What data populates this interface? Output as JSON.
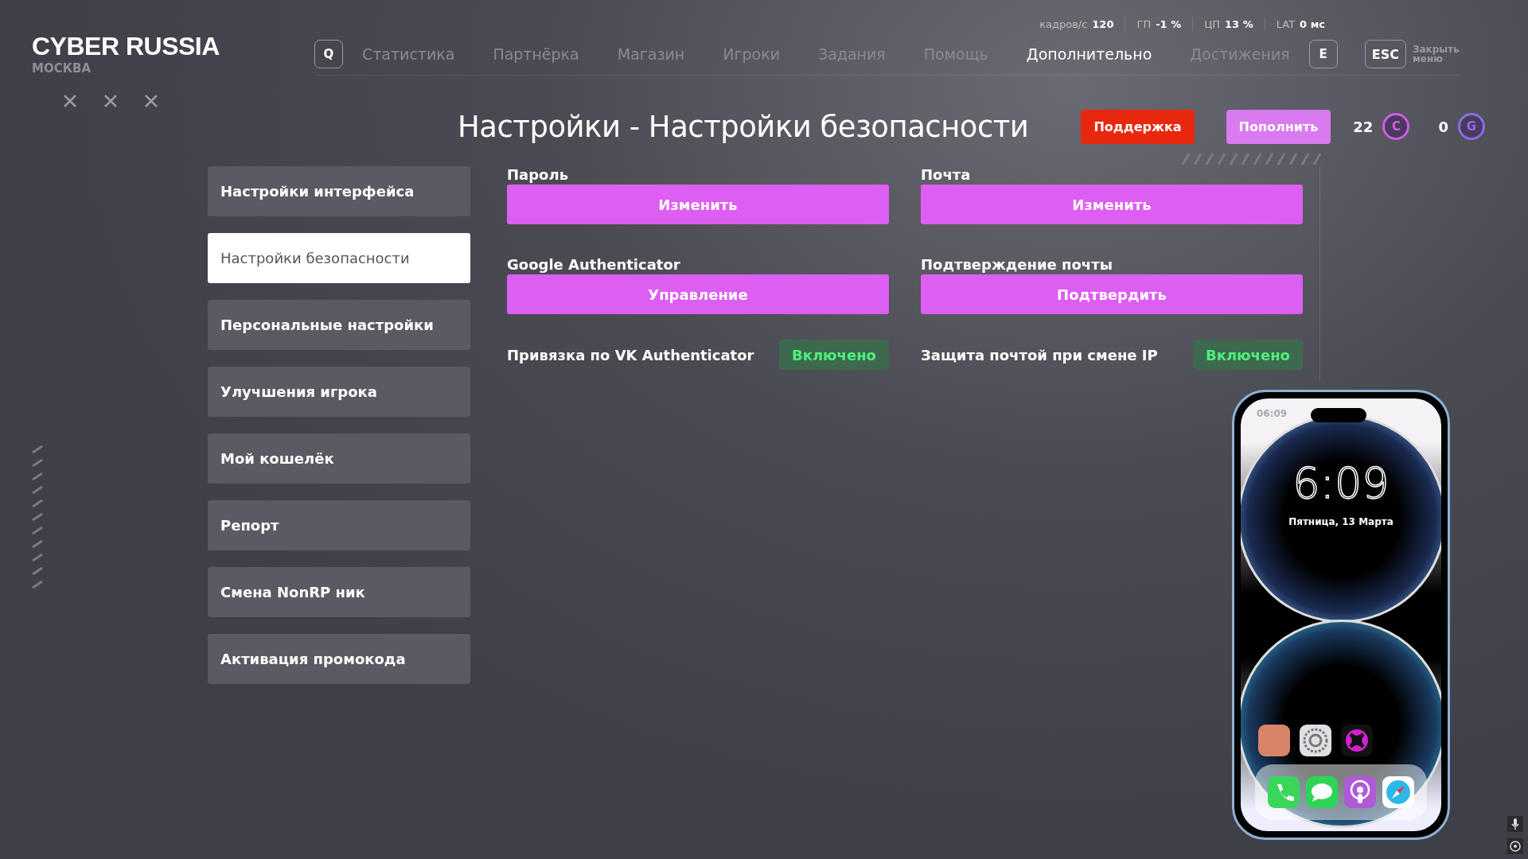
{
  "brand": {
    "title": "CYBER RUSSIA",
    "city": "МОСКВА"
  },
  "stats": [
    {
      "label": "кадров/с",
      "value": "120"
    },
    {
      "label": "ГП",
      "value": "-1 %"
    },
    {
      "label": "ЦП",
      "value": "13 %"
    },
    {
      "label": "LAT",
      "value": "0 мс"
    }
  ],
  "nav": {
    "prev_key": "Q",
    "next_key": "E",
    "items": [
      {
        "label": "Статистика",
        "selected": false
      },
      {
        "label": "Партнёрка",
        "selected": false
      },
      {
        "label": "Магазин",
        "selected": false
      },
      {
        "label": "Игроки",
        "selected": false
      },
      {
        "label": "Задания",
        "selected": false
      },
      {
        "label": "Помощь",
        "selected": false
      },
      {
        "label": "Дополнительно",
        "selected": true
      },
      {
        "label": "Достижения",
        "selected": false
      }
    ]
  },
  "close": {
    "key": "ESC",
    "label": "Закрыть меню"
  },
  "page_title": "Настройки - Настройки безопасности",
  "actions": {
    "support": "Поддержка",
    "topup": "Пополнить",
    "balances": [
      {
        "amount": "22",
        "currency": "C",
        "color": "#d05ce0"
      },
      {
        "amount": "0",
        "currency": "G",
        "color": "#8a6ee0"
      }
    ]
  },
  "sidebar": [
    {
      "label": "Настройки интерфейса",
      "selected": false
    },
    {
      "label": "Настройки безопасности",
      "selected": true
    },
    {
      "label": "Персональные настройки",
      "selected": false
    },
    {
      "label": "Улучшения игрока",
      "selected": false
    },
    {
      "label": "Мой кошелёк",
      "selected": false
    },
    {
      "label": "Репорт",
      "selected": false
    },
    {
      "label": "Смена NonRP ник",
      "selected": false
    },
    {
      "label": "Активация промокода",
      "selected": false
    }
  ],
  "settings": [
    {
      "kind": "button",
      "label": "Пароль",
      "action": "Изменить"
    },
    {
      "kind": "button",
      "label": "Почта",
      "action": "Изменить"
    },
    {
      "kind": "button",
      "label": "Google Authenticator",
      "action": "Управление"
    },
    {
      "kind": "button",
      "label": "Подтверждение почты",
      "action": "Подтвердить"
    },
    {
      "kind": "toggle",
      "label": "Привязка по VK Authenticator",
      "status": "Включено",
      "on": true
    },
    {
      "kind": "toggle",
      "label": "Защита почтой при смене IP",
      "status": "Включено",
      "on": true
    }
  ],
  "phone": {
    "status_time": "06:09",
    "clock": "6:09",
    "date": "Пятница, 13 Марта"
  }
}
